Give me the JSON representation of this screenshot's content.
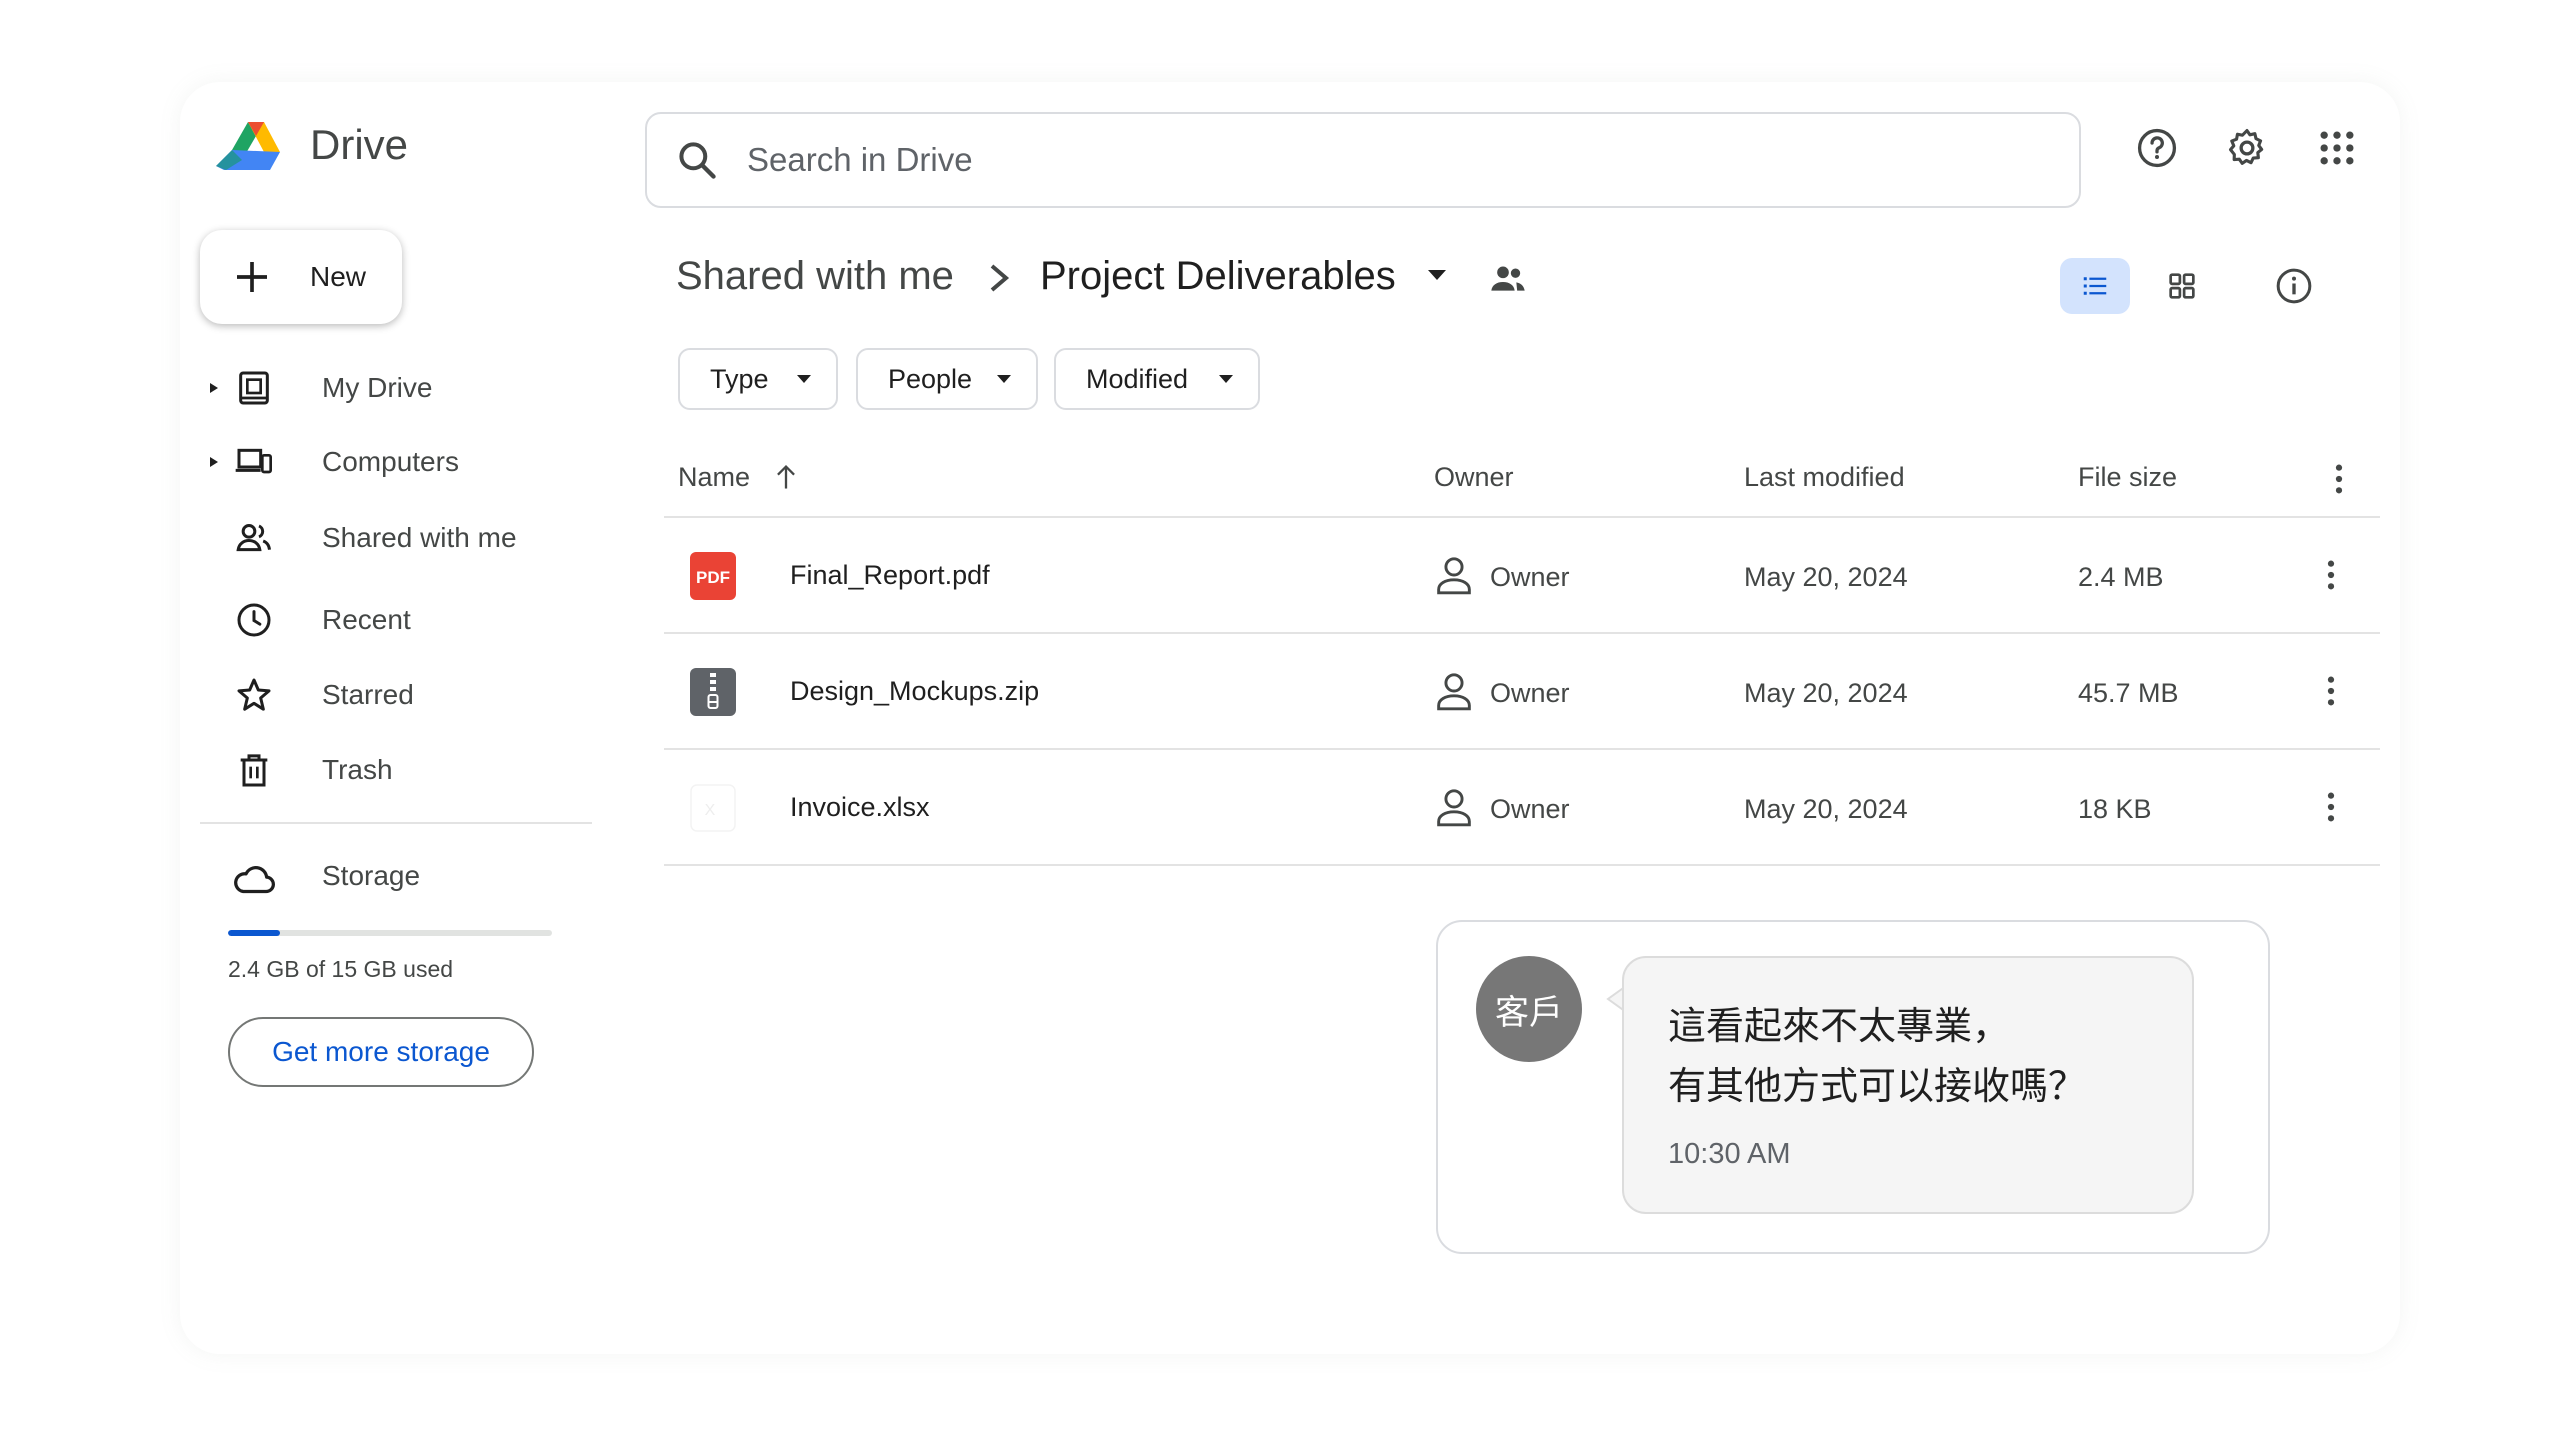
{
  "app": {
    "name": "Drive"
  },
  "search": {
    "placeholder": "Search in Drive"
  },
  "new_button": {
    "label": "New"
  },
  "sidebar": {
    "items": [
      {
        "label": "My Drive",
        "icon": "my-drive-icon"
      },
      {
        "label": "Computers",
        "icon": "computers-icon"
      },
      {
        "label": "Shared with me",
        "icon": "shared-icon"
      },
      {
        "label": "Recent",
        "icon": "clock-icon"
      },
      {
        "label": "Starred",
        "icon": "star-icon"
      },
      {
        "label": "Trash",
        "icon": "trash-icon"
      }
    ]
  },
  "storage": {
    "label": "Storage",
    "used_text": "2.4 GB of 15 GB used",
    "used_fraction": 0.16,
    "cta": "Get more storage"
  },
  "breadcrumb": {
    "root": "Shared with me",
    "current": "Project Deliverables"
  },
  "filters": {
    "type": "Type",
    "people": "People",
    "modified": "Modified"
  },
  "table": {
    "headers": {
      "name": "Name",
      "owner": "Owner",
      "modified": "Last modified",
      "size": "File size"
    },
    "rows": [
      {
        "name": "Final_Report.pdf",
        "kind": "pdf",
        "owner": "Owner",
        "modified": "May 20, 2024",
        "size": "2.4 MB"
      },
      {
        "name": "Design_Mockups.zip",
        "kind": "zip",
        "owner": "Owner",
        "modified": "May 20, 2024",
        "size": "45.7 MB"
      },
      {
        "name": "Invoice.xlsx",
        "kind": "xlsx",
        "owner": "Owner",
        "modified": "May 20, 2024",
        "size": "18 KB"
      }
    ]
  },
  "chat": {
    "avatar_text": "客戶",
    "message": "這看起來不太專業，\n有其他方式可以接收嗎？",
    "time": "10:30 AM"
  },
  "colors": {
    "accent": "#0b57d0",
    "selected_view_bg": "#d3e3fd",
    "pdf_red": "#ea4335",
    "zip_gray": "#5f6368",
    "avatar_gray": "#777777"
  }
}
